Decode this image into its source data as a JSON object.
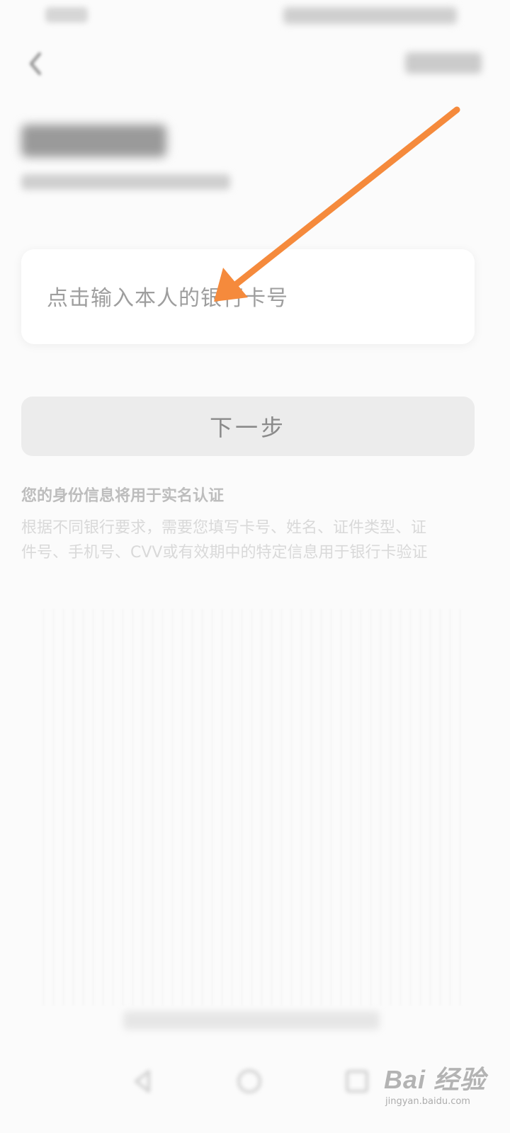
{
  "card_input": {
    "placeholder": "点击输入本人的银行卡号"
  },
  "next_button": {
    "label": "下一步"
  },
  "info": {
    "title": "您的身份信息将用于实名认证",
    "body_line_1": "根据不同银行要求，需要您填写卡号、姓名、证件类型、证",
    "body_line_2": "件号、手机号、CVV或有效期中的特定信息用于银行卡验证"
  },
  "annotation": {
    "arrow_color": "#F58A3C"
  },
  "watermark": {
    "brand": "Bai 经验",
    "url": "jingyan.baidu.com"
  },
  "colors": {
    "background": "#FBFBFB",
    "card": "#FFFFFF",
    "button": "#ECECEC"
  }
}
